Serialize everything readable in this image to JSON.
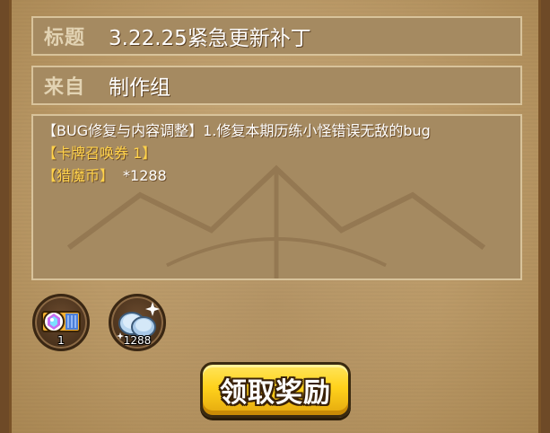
{
  "mail": {
    "title_label": "标题",
    "title_value": "3.22.25紧急更新补丁",
    "from_label": "来自",
    "from_value": "制作组",
    "body_lines": [
      "【BUG修复与内容调整】1.修复本期历练小怪错误无敌的bug",
      "【卡牌召唤券 1】",
      "【猎魔币】"
    ],
    "gold_amount": "*1288"
  },
  "rewards": [
    {
      "icon": "summon-ticket-icon",
      "count": "1"
    },
    {
      "icon": "silver-coins-icon",
      "count": "1288"
    }
  ],
  "claim_button_label": "领取奖励",
  "colors": {
    "parchment": "#c9ab7c",
    "field_bg": "#a58a61",
    "gold_text": "#ffd24a",
    "button_yellow": "#ffd21c"
  }
}
